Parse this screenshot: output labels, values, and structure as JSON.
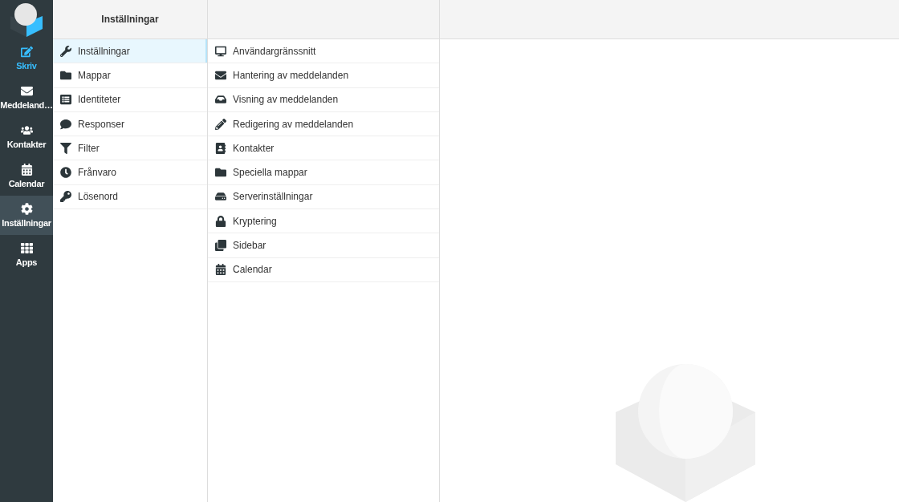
{
  "nav": [
    {
      "label": "Skriv",
      "kind": "compose",
      "selected": false
    },
    {
      "label": "Meddeland…",
      "kind": "link",
      "selected": false
    },
    {
      "label": "Kontakter",
      "kind": "link",
      "selected": false
    },
    {
      "label": "Calendar",
      "kind": "link",
      "selected": false
    },
    {
      "label": "Inställningar",
      "kind": "link",
      "selected": true
    },
    {
      "label": "Apps",
      "kind": "link",
      "selected": false
    }
  ],
  "sections": {
    "title": "Inställningar",
    "items": [
      {
        "label": "Inställningar",
        "selected": true
      },
      {
        "label": "Mappar",
        "selected": false
      },
      {
        "label": "Identiteter",
        "selected": false
      },
      {
        "label": "Responser",
        "selected": false
      },
      {
        "label": "Filter",
        "selected": false
      },
      {
        "label": "Frånvaro",
        "selected": false
      },
      {
        "label": "Lösenord",
        "selected": false
      }
    ]
  },
  "preferences": [
    {
      "label": "Användargränssnitt",
      "selected": false
    },
    {
      "label": "Hantering av meddelanden",
      "selected": false
    },
    {
      "label": "Visning av meddelanden",
      "selected": false
    },
    {
      "label": "Redigering av meddelanden",
      "selected": false
    },
    {
      "label": "Kontakter",
      "selected": false
    },
    {
      "label": "Speciella mappar",
      "selected": false
    },
    {
      "label": "Serverinställningar",
      "selected": false
    },
    {
      "label": "Kryptering",
      "selected": false
    },
    {
      "label": "Sidebar",
      "selected": false
    },
    {
      "label": "Calendar",
      "selected": false
    }
  ]
}
